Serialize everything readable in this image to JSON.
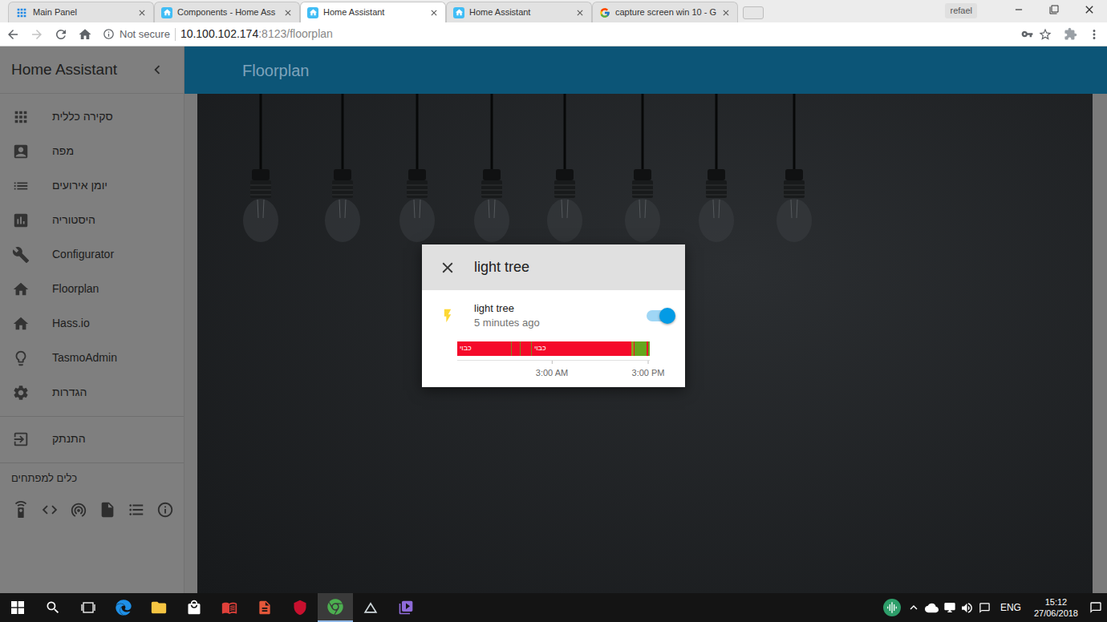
{
  "browser": {
    "tabs": [
      {
        "title": "Main Panel",
        "kind": "grid",
        "selected": false
      },
      {
        "title": "Components - Home Ass",
        "kind": "ha",
        "selected": false
      },
      {
        "title": "Home Assistant",
        "kind": "ha",
        "selected": true
      },
      {
        "title": "Home Assistant",
        "kind": "ha",
        "selected": false
      },
      {
        "title": "capture screen win 10 - G",
        "kind": "google",
        "selected": false
      }
    ],
    "profile": "refael",
    "address": {
      "security": "Not secure",
      "host": "10.100.102.174",
      "path": ":8123/floorplan"
    }
  },
  "sidebar": {
    "title": "Home Assistant",
    "items": [
      {
        "label": "סקירה כללית",
        "selected": false
      },
      {
        "label": "מפה",
        "selected": false
      },
      {
        "label": "יומן אירועים",
        "selected": false
      },
      {
        "label": "היסטוריה",
        "selected": false
      },
      {
        "label": "Configurator",
        "selected": false
      },
      {
        "label": "Floorplan",
        "selected": false
      },
      {
        "label": "Hass.io",
        "selected": false
      },
      {
        "label": "TasmoAdmin",
        "selected": false
      },
      {
        "label": "הגדרות",
        "selected": false
      }
    ],
    "logout": "התנתק",
    "dev_tools_title": "כלים למפתחים"
  },
  "header": {
    "title": "Floorplan"
  },
  "dialog": {
    "title": "light tree",
    "entity": {
      "name": "light tree",
      "last_changed": "5 minutes ago",
      "on": true
    },
    "history": {
      "segments": [
        {
          "label": "כבוי",
          "start": 0,
          "end": 6.7,
          "color": "#f50a2a"
        },
        {
          "label": "",
          "start": 6.7,
          "end": 6.8,
          "color": "#7a8a1e"
        },
        {
          "label": "",
          "start": 6.8,
          "end": 7.8,
          "color": "#f50a2a"
        },
        {
          "label": "",
          "start": 7.8,
          "end": 7.9,
          "color": "#7a8a1e"
        },
        {
          "label": "",
          "start": 7.9,
          "end": 9.2,
          "color": "#f50a2a"
        },
        {
          "label": "",
          "start": 9.2,
          "end": 9.3,
          "color": "#7a8a1e"
        },
        {
          "label": "כבוי",
          "start": 9.3,
          "end": 21.7,
          "color": "#f50a2a"
        },
        {
          "label": "",
          "start": 21.7,
          "end": 22.0,
          "color": "#8aa21e"
        },
        {
          "label": "",
          "start": 22.0,
          "end": 22.1,
          "color": "#f50a2a"
        },
        {
          "label": "",
          "start": 22.1,
          "end": 23.6,
          "color": "#66a61e"
        },
        {
          "label": "",
          "start": 23.6,
          "end": 23.8,
          "color": "#f50a2a"
        },
        {
          "label": "",
          "start": 23.8,
          "end": 24,
          "color": "#66a61e"
        }
      ],
      "ticks": [
        {
          "label": "3:00 AM",
          "hour": 11.8
        },
        {
          "label": "3:00 PM",
          "hour": 23.8
        }
      ]
    }
  },
  "taskbar": {
    "language": "ENG",
    "time": "15:12",
    "date": "27/06/2018"
  }
}
